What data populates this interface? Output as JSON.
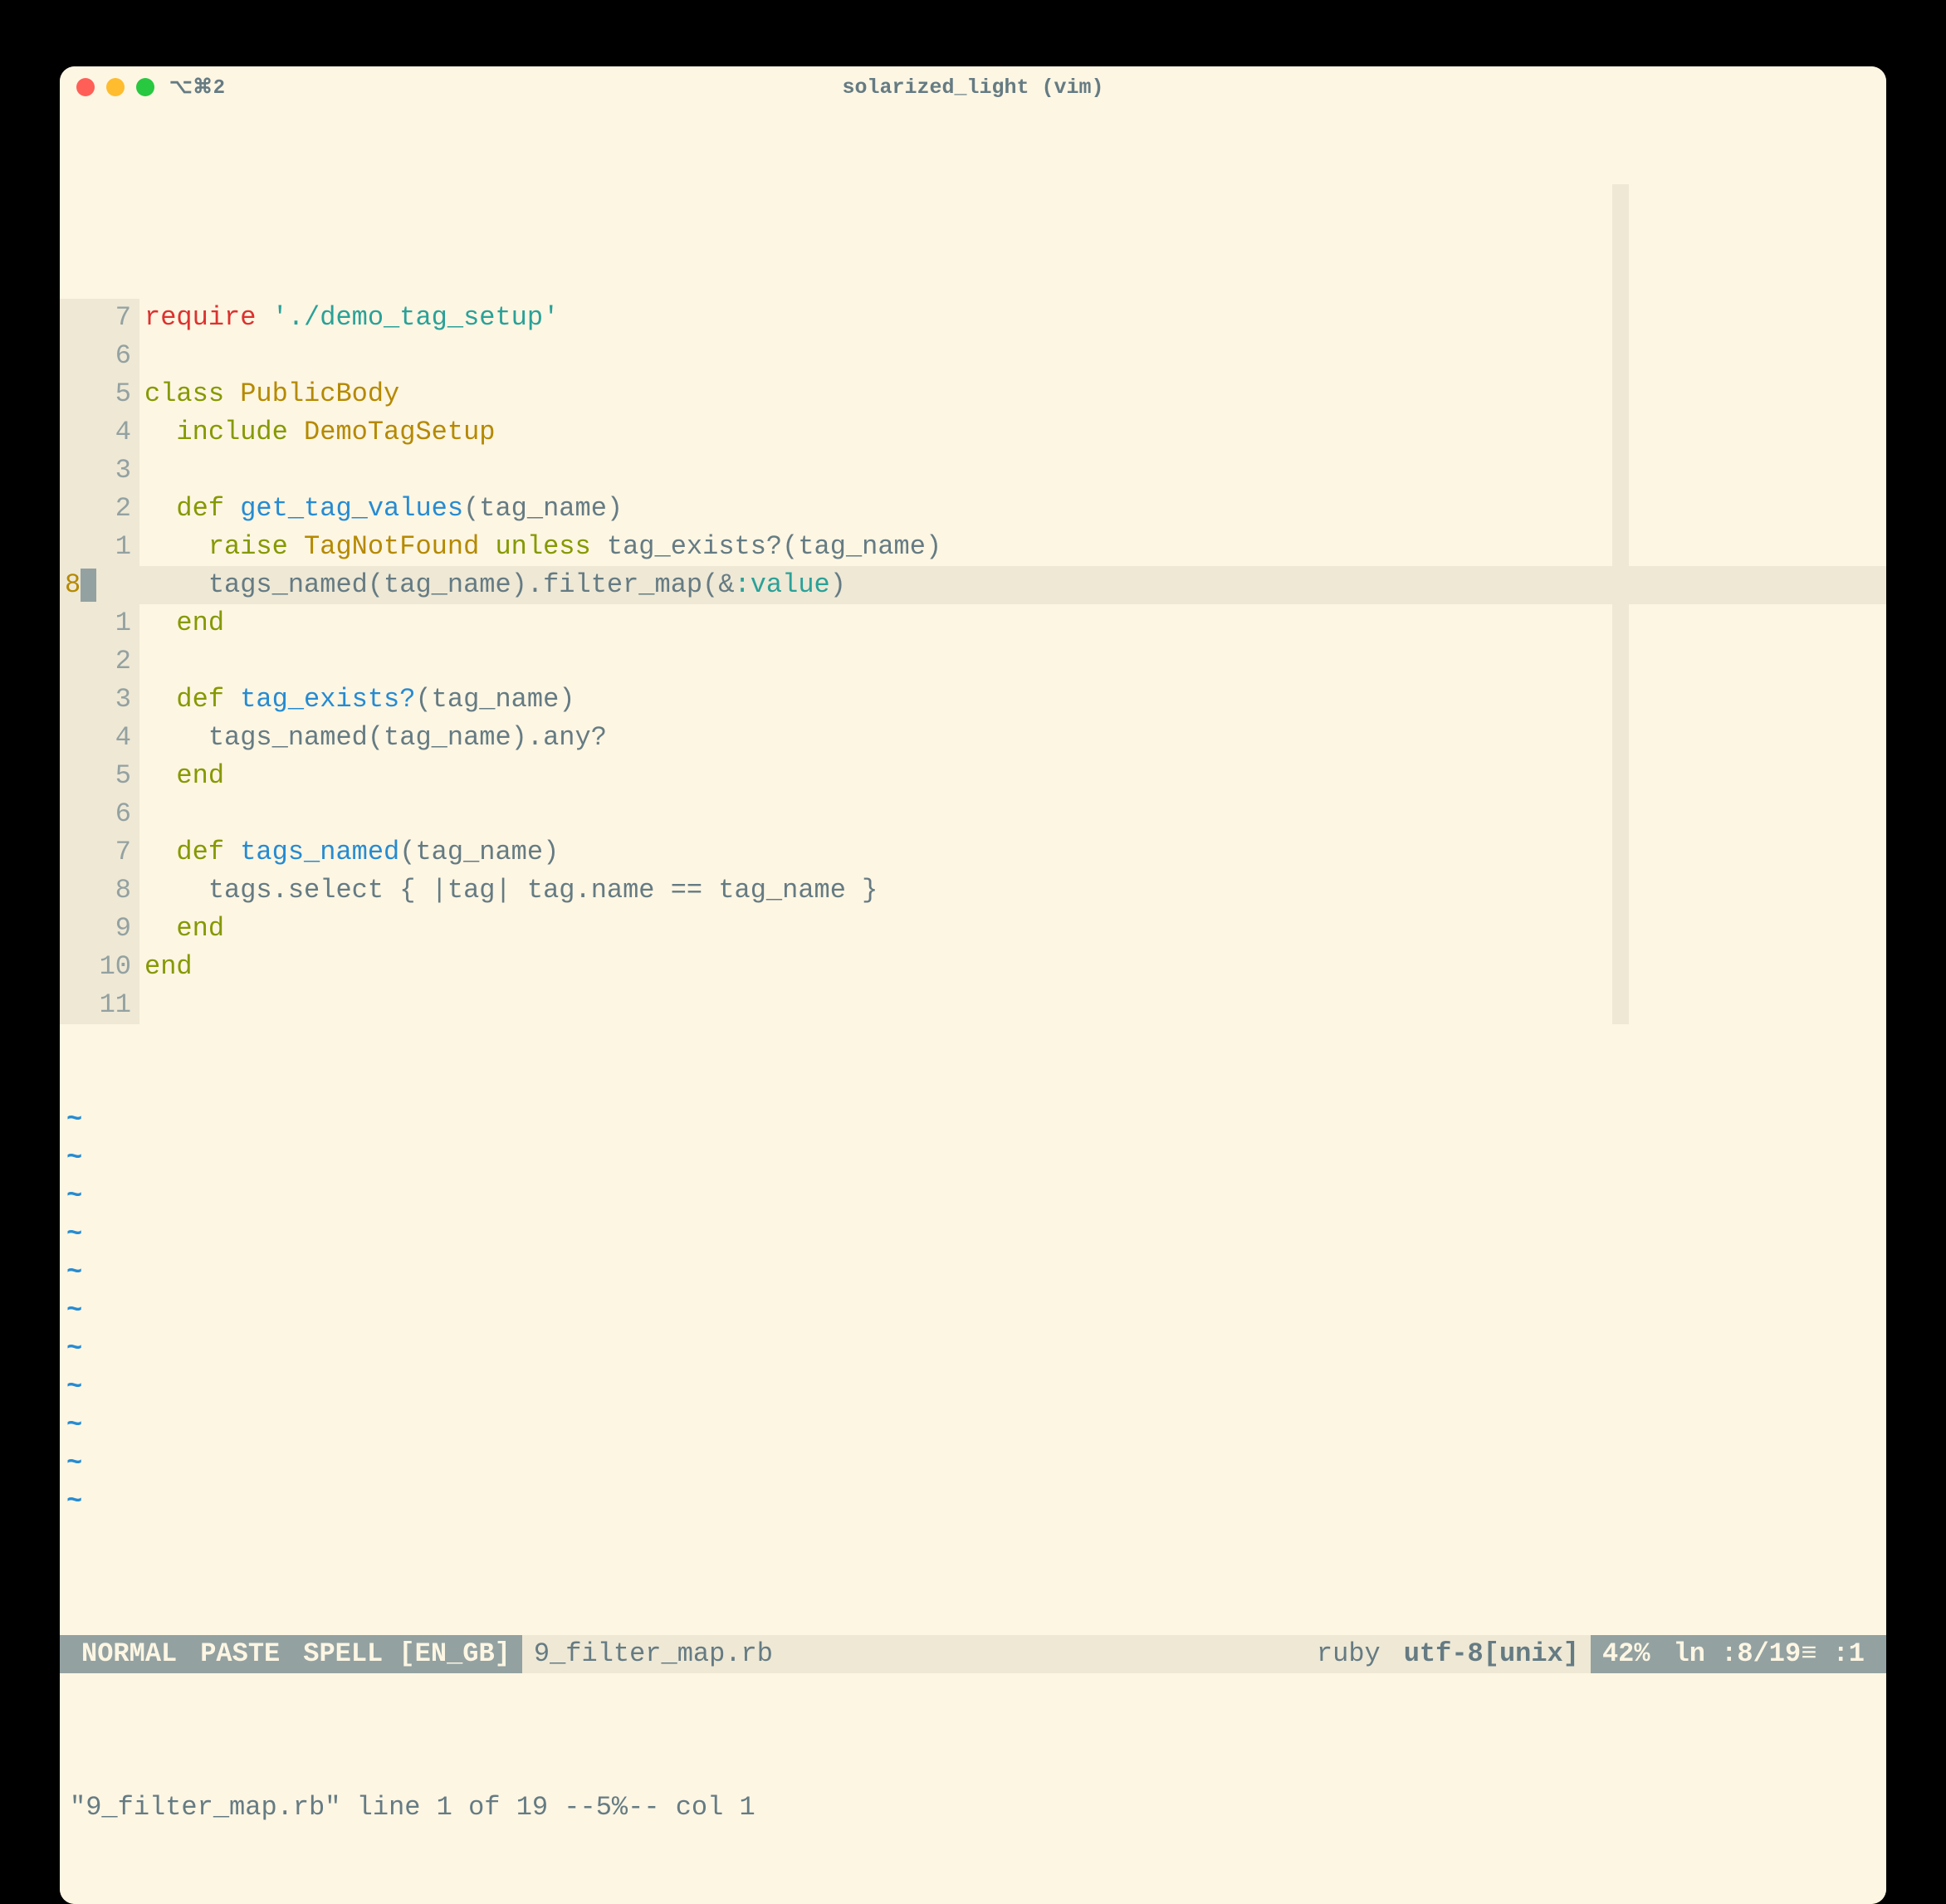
{
  "titlebar": {
    "tab": "⌥⌘2",
    "title": "solarized_light (vim)"
  },
  "gutter_numbers": [
    "7",
    "6",
    "5",
    "4",
    "3",
    "2",
    "1",
    "8",
    "1",
    "2",
    "3",
    "4",
    "5",
    "6",
    "7",
    "8",
    "9",
    "10",
    "11"
  ],
  "current_line_index": 7,
  "code_lines": [
    [
      {
        "cls": "kw-require",
        "t": "require"
      },
      {
        "cls": "",
        "t": " "
      },
      {
        "cls": "str",
        "t": "'./demo_tag_setup'"
      }
    ],
    [],
    [
      {
        "cls": "kw-class",
        "t": "class"
      },
      {
        "cls": "",
        "t": " "
      },
      {
        "cls": "classname",
        "t": "PublicBody"
      }
    ],
    [
      {
        "cls": "",
        "t": "  "
      },
      {
        "cls": "kw-include",
        "t": "include"
      },
      {
        "cls": "",
        "t": " "
      },
      {
        "cls": "modname",
        "t": "DemoTagSetup"
      }
    ],
    [],
    [
      {
        "cls": "",
        "t": "  "
      },
      {
        "cls": "kw-def",
        "t": "def"
      },
      {
        "cls": "",
        "t": " "
      },
      {
        "cls": "method",
        "t": "get_tag_values"
      },
      {
        "cls": "",
        "t": "(tag_name)"
      }
    ],
    [
      {
        "cls": "",
        "t": "    "
      },
      {
        "cls": "kw-raise",
        "t": "raise"
      },
      {
        "cls": "",
        "t": " "
      },
      {
        "cls": "exc",
        "t": "TagNotFound"
      },
      {
        "cls": "",
        "t": " "
      },
      {
        "cls": "kw-unless",
        "t": "unless"
      },
      {
        "cls": "",
        "t": " tag_exists?(tag_name)"
      }
    ],
    [
      {
        "cls": "",
        "t": "    tags_named(tag_name).filter_map(&"
      },
      {
        "cls": "sym",
        "t": ":value"
      },
      {
        "cls": "",
        "t": ")"
      }
    ],
    [
      {
        "cls": "",
        "t": "  "
      },
      {
        "cls": "kw-end",
        "t": "end"
      }
    ],
    [],
    [
      {
        "cls": "",
        "t": "  "
      },
      {
        "cls": "kw-def",
        "t": "def"
      },
      {
        "cls": "",
        "t": " "
      },
      {
        "cls": "method",
        "t": "tag_exists?"
      },
      {
        "cls": "",
        "t": "(tag_name)"
      }
    ],
    [
      {
        "cls": "",
        "t": "    tags_named(tag_name).any?"
      }
    ],
    [
      {
        "cls": "",
        "t": "  "
      },
      {
        "cls": "kw-end",
        "t": "end"
      }
    ],
    [],
    [
      {
        "cls": "",
        "t": "  "
      },
      {
        "cls": "kw-def",
        "t": "def"
      },
      {
        "cls": "",
        "t": " "
      },
      {
        "cls": "method",
        "t": "tags_named"
      },
      {
        "cls": "",
        "t": "(tag_name)"
      }
    ],
    [
      {
        "cls": "",
        "t": "    tags.select { |tag| tag.name == tag_name }"
      }
    ],
    [
      {
        "cls": "",
        "t": "  "
      },
      {
        "cls": "kw-end",
        "t": "end"
      }
    ],
    [
      {
        "cls": "kw-end",
        "t": "end"
      }
    ],
    []
  ],
  "tilde_count": 11,
  "statusline": {
    "mode": "NORMAL",
    "paste": "PASTE",
    "spell": "SPELL [EN_GB]",
    "filename": "9_filter_map.rb",
    "filetype": "ruby",
    "encoding": "utf-8[unix]",
    "percent": "42%",
    "position": "ln :8/19≡ :1"
  },
  "commandline": "\"9_filter_map.rb\" line 1 of 19 --5%-- col 1"
}
